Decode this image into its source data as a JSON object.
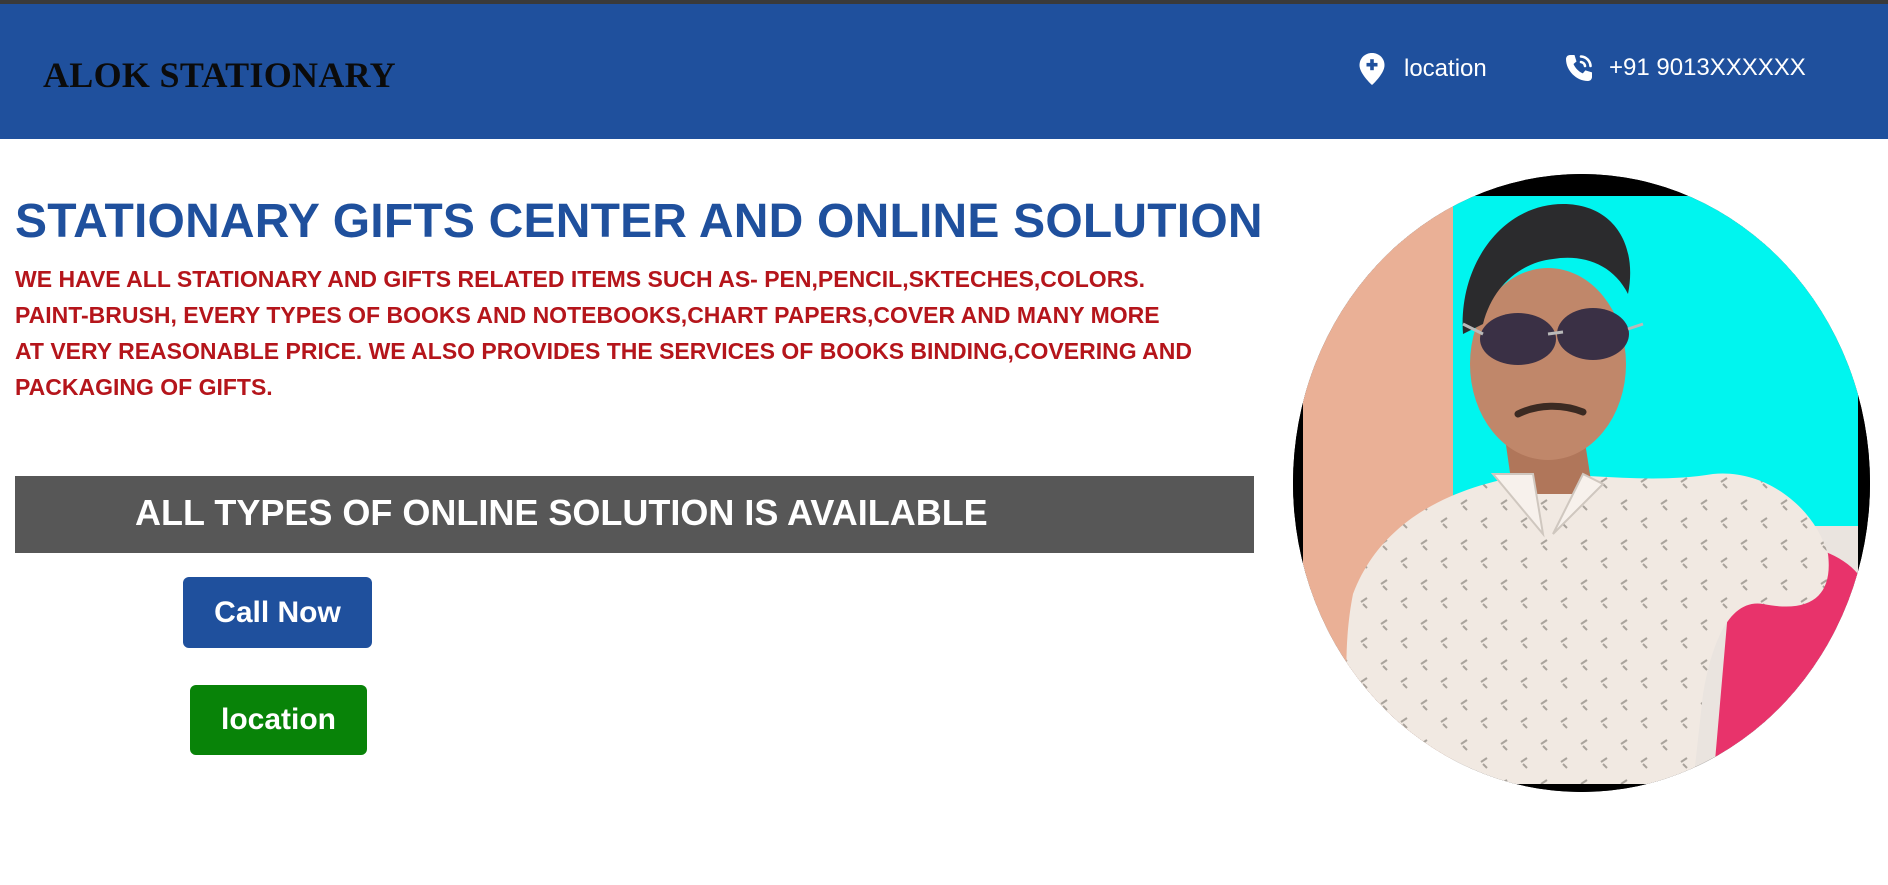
{
  "header": {
    "brand": "ALOK STATIONARY",
    "location_label": "location",
    "phone_label": "+91 9013XXXXXX",
    "location_icon": "map-pin-plus-icon",
    "phone_icon": "phone-call-icon"
  },
  "main": {
    "headline": "STATIONARY GIFTS CENTER AND ONLINE SOLUTION",
    "description_lines": [
      "WE HAVE ALL STATIONARY AND GIFTS RELATED ITEMS SUCH AS- PEN,PENCIL,SKTECHES,COLORS.",
      "PAINT-BRUSH, EVERY TYPES OF BOOKS AND NOTEBOOKS,CHART PAPERS,COVER AND MANY MORE",
      "AT VERY REASONABLE PRICE. WE ALSO PROVIDES THE SERVICES OF BOOKS BINDING,COVERING AND",
      "PACKAGING OF GIFTS."
    ],
    "banner_text": "ALL TYPES OF ONLINE SOLUTION IS AVAILABLE",
    "call_button_label": "Call Now",
    "location_button_label": "location"
  },
  "colors": {
    "header_bg": "#1f509d",
    "headline": "#1f509d",
    "description": "#b5151b",
    "banner_bg": "#575757",
    "call_button_bg": "#1f509d",
    "location_button_bg": "#088308"
  }
}
